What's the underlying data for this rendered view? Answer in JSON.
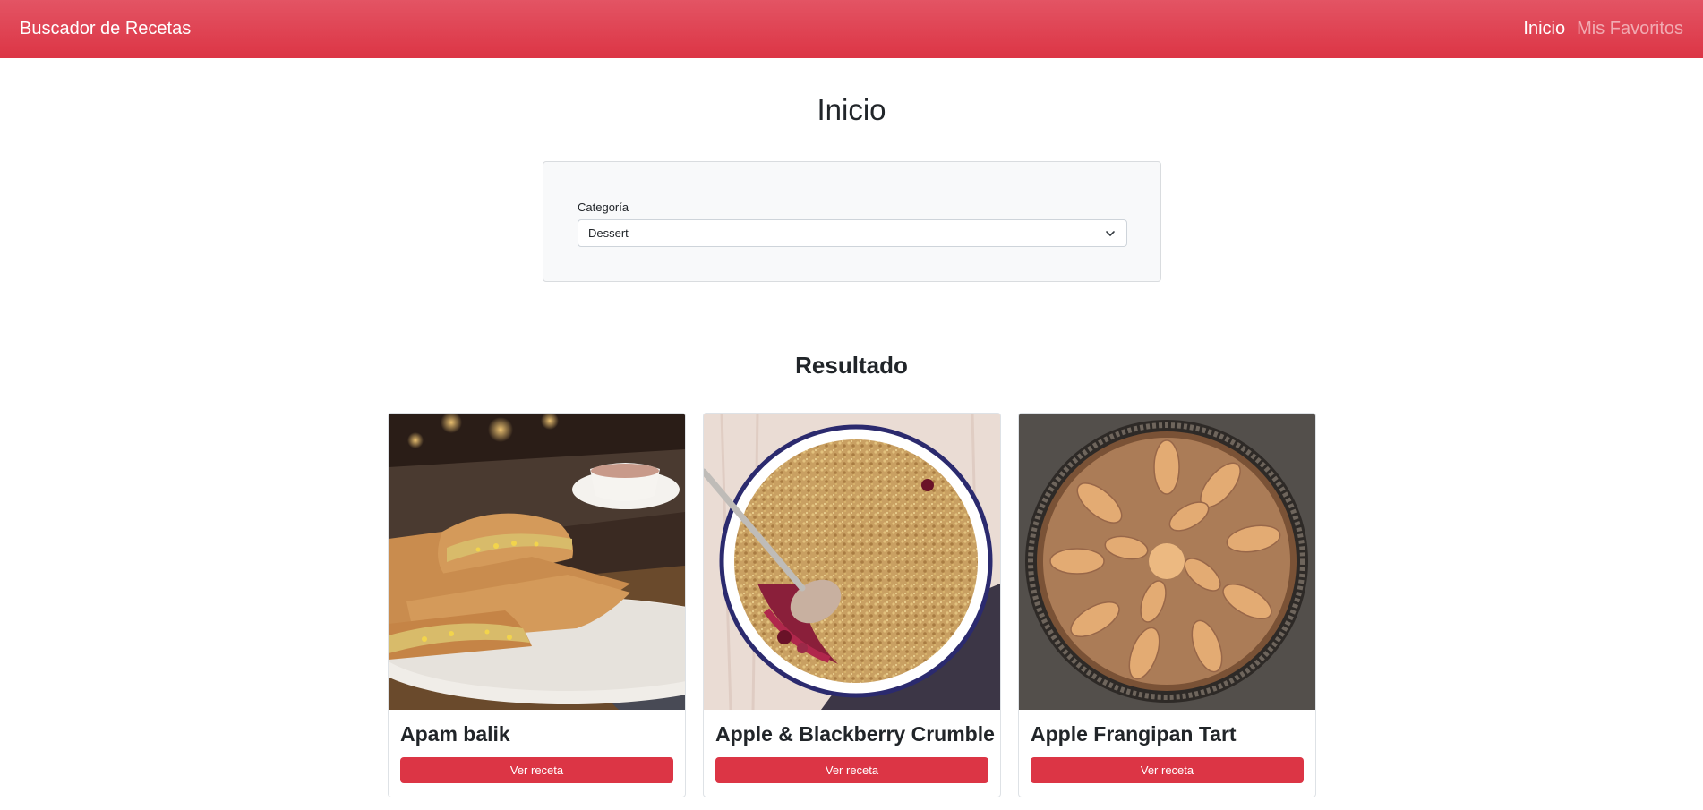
{
  "navbar": {
    "brand": "Buscador de Recetas",
    "links": [
      {
        "label": "Inicio",
        "active": true
      },
      {
        "label": "Mis Favoritos",
        "active": false
      }
    ]
  },
  "page_title": "Inicio",
  "filter": {
    "label": "Categoría",
    "selected": "Dessert",
    "icon": "chevron-down-icon"
  },
  "results_title": "Resultado",
  "recipes": [
    {
      "title": "Apam balik",
      "button_label": "Ver receta"
    },
    {
      "title": "Apple & Blackberry Crumble",
      "button_label": "Ver receta"
    },
    {
      "title": "Apple Frangipan Tart",
      "button_label": "Ver receta"
    }
  ],
  "colors": {
    "primary": "#dc3545",
    "navbar_top": "#e35464",
    "card_bg": "#f8f9fa"
  }
}
